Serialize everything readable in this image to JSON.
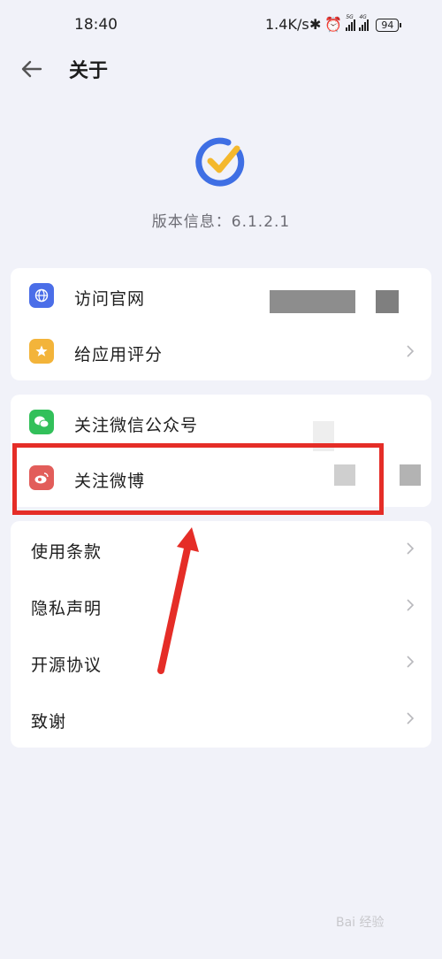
{
  "status": {
    "time": "18:40",
    "net_speed": "1.4K/s",
    "battery": "94",
    "sig1_tag": "5G",
    "sig2_tag": "4G"
  },
  "header": {
    "title": "关于"
  },
  "app": {
    "version_label": "版本信息：6.1.2.1"
  },
  "menu": {
    "group1": [
      {
        "label": "访问官网",
        "icon": "globe-icon",
        "icon_color": "#4b6ee8"
      },
      {
        "label": "给应用评分",
        "icon": "star-icon",
        "icon_color": "#f3b43a"
      }
    ],
    "group2": [
      {
        "label": "关注微信公众号",
        "icon": "wechat-icon",
        "icon_color": "#32c05a"
      },
      {
        "label": "关注微博",
        "icon": "weibo-icon",
        "icon_color": "#e25d5a"
      }
    ],
    "group3": [
      {
        "label": "使用条款"
      },
      {
        "label": "隐私声明"
      },
      {
        "label": "开源协议"
      },
      {
        "label": "致谢"
      }
    ]
  },
  "colors": {
    "background": "#f1f2f9",
    "card": "#ffffff",
    "annotation": "#e52d27",
    "logo_blue": "#3f6fe4",
    "logo_yellow": "#f4b82d"
  },
  "watermark": "Bai 经验"
}
